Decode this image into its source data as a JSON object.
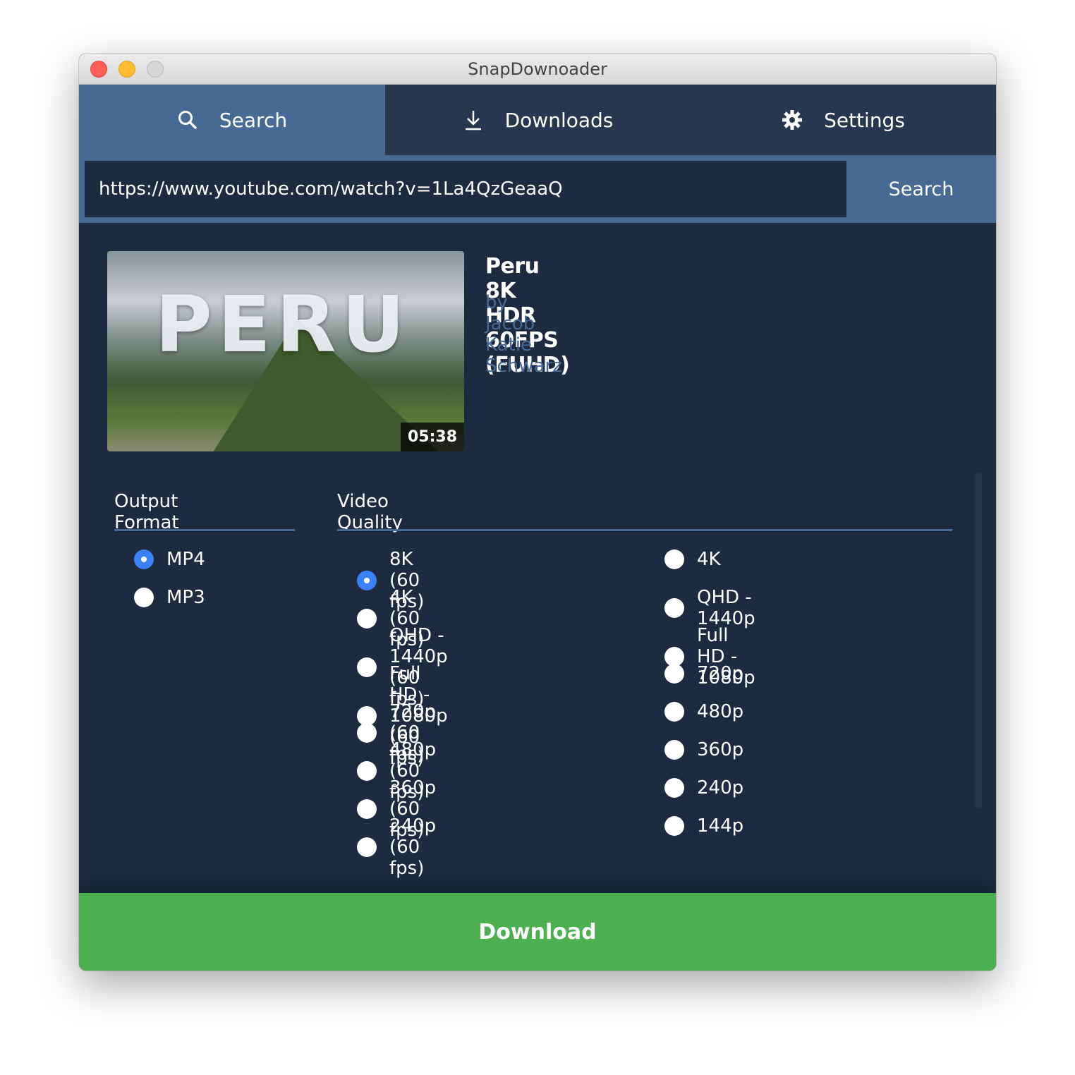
{
  "window": {
    "title": "SnapDownoader"
  },
  "tabs": [
    {
      "label": "Search",
      "icon": "search-icon",
      "active": true
    },
    {
      "label": "Downloads",
      "icon": "download-icon"
    },
    {
      "label": "Settings",
      "icon": "gear-icon"
    }
  ],
  "search": {
    "url": "https://www.youtube.com/watch?v=1La4QzGeaaQ",
    "button": "Search"
  },
  "video": {
    "title": "Peru 8K HDR 60FPS (FUHD)",
    "author": "by Jacob Katie Schwarz",
    "duration": "05:38",
    "thumb_text": "PERU"
  },
  "output_format": {
    "label": "Output Format",
    "options": [
      "MP4",
      "MP3"
    ],
    "selected": "MP4"
  },
  "video_quality": {
    "label": "Video Quality",
    "col1": [
      "8K (60 fps)",
      "4K (60 fps)",
      "QHD - 1440p (60 fps)",
      "Full HD - 1080p (60 fps)",
      "720p (60 fps)",
      "480p (60 fps)",
      "360p (60 fps)",
      "240p (60 fps)"
    ],
    "col2": [
      "4K",
      "QHD - 1440p",
      "Full HD - 1080p",
      "720p",
      "480p",
      "360p",
      "240p",
      "144p"
    ],
    "selected": "8K (60 fps)"
  },
  "download_button": "Download",
  "colors": {
    "accent": "#476a94",
    "background": "#1e2a40",
    "download": "#4caf50",
    "radio_selected": "#3b82f6"
  }
}
